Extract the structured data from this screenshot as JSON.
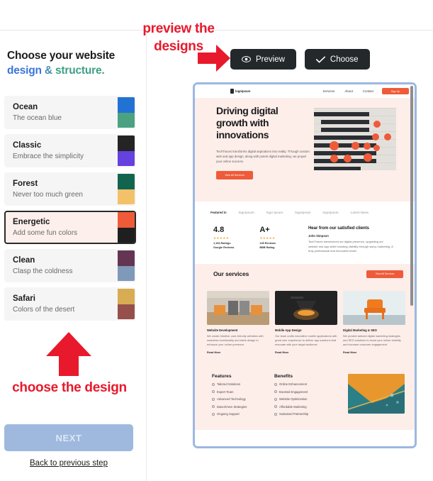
{
  "left_panel": {
    "headline_line1": "Choose your website",
    "headline_line2_a": "design",
    "headline_line2_b": " & ",
    "headline_line2_c": "structure.",
    "themes": [
      {
        "name": "Ocean",
        "desc": "The ocean blue",
        "color_top": "#2272d4",
        "color_bottom": "#4ba283",
        "selected": false
      },
      {
        "name": "Classic",
        "desc": "Embrace the simplicity",
        "color_top": "#242424",
        "color_bottom": "#6541e0",
        "selected": false
      },
      {
        "name": "Forest",
        "desc": "Never too much green",
        "color_top": "#11654f",
        "color_bottom": "#f3c169",
        "selected": false
      },
      {
        "name": "Energetic",
        "desc": "Add some fun colors",
        "color_top": "#ef5b39",
        "color_bottom": "#1f1f1f",
        "selected": true
      },
      {
        "name": "Clean",
        "desc": "Clasp the coldness",
        "color_top": "#643453",
        "color_bottom": "#7f99b8",
        "selected": false
      },
      {
        "name": "Safari",
        "desc": "Colors of the desert",
        "color_top": "#d8ac52",
        "color_bottom": "#96504c",
        "selected": false
      }
    ],
    "next_label": "NEXT",
    "back_label": "Back to previous step"
  },
  "toolbar": {
    "preview_label": "Preview",
    "choose_label": "Choose"
  },
  "annotations": {
    "preview_text": "preview the designs",
    "choose_text": "choose the design",
    "color": "#e8192c"
  },
  "preview": {
    "nav": {
      "logo": "logoipsum",
      "links": [
        "Services",
        "About",
        "Contact"
      ],
      "cta": "Sign Up"
    },
    "hero": {
      "title": "Driving digital growth with innovations",
      "body": "TechTraces transforms digital aspirations into reality. Through custom web and app design, along with potent digital marketing, we propel your online success.",
      "cta": "View All Services"
    },
    "featured": {
      "label": "Featured in",
      "logos": [
        "logoipsum",
        "logo ipsum",
        "logoipsum",
        "logoipsum",
        "Latest News"
      ]
    },
    "stats": [
      {
        "num": "4.8",
        "stars": "★★★★★",
        "line1": "1,194 Ratings",
        "line2": "Google Reviews"
      },
      {
        "num": "A+",
        "stars": "★★★★★",
        "line1": "135 Reviews",
        "line2": "BBB Rating"
      }
    ],
    "testimonial": {
      "heading": "Hear from our satisfied clients",
      "author": "John Simpson",
      "body": "TechTraces transformed our digital presence, upgrading our website and app while boosting visibility through savvy marketing. A truly professional and innovative team!"
    },
    "services": {
      "heading": "Our services",
      "cta": "View All Services",
      "cards": [
        {
          "title": "Website Development",
          "desc": "We create intuitive, user-friendly websites with seamless functionality and sleek design to enhance your online presence.",
          "read_more": "Read More"
        },
        {
          "title": "Mobile App Design",
          "desc": "Our team crafts innovative mobile applications with great user experience to deliver app solutions that resonate with your target audience.",
          "read_more": "Read More"
        },
        {
          "title": "Digital Marketing & SEO",
          "desc": "We provide tailored digital marketing strategies and SEO solutions to boost your online visibility and increase customer engagement.",
          "read_more": "Read More"
        }
      ]
    },
    "features": {
      "col1_heading": "Features",
      "col1_items": [
        "Tailored Solutions",
        "Expert Team",
        "Advanced Technology",
        "Data-Driven Strategies",
        "Ongoing Support"
      ],
      "col2_heading": "Benefits",
      "col2_items": [
        "Online Enhancement",
        "Boosted Engagement",
        "Website Optimization",
        "Affordable Marketing",
        "Sustained Partnership"
      ]
    }
  }
}
